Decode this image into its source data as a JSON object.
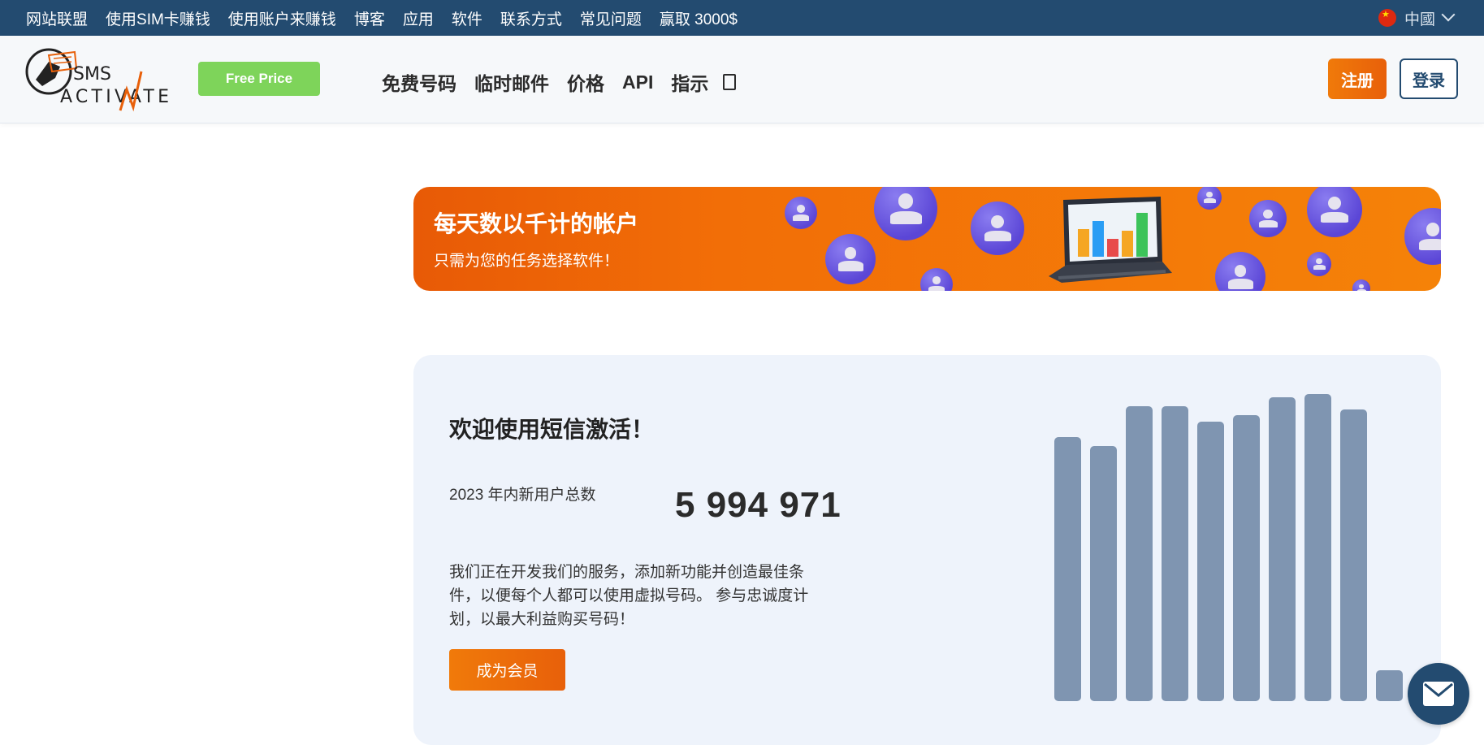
{
  "topbar": {
    "links": [
      "网站联盟",
      "使用SIM卡赚钱",
      "使用账户来赚钱",
      "博客",
      "应用",
      "软件",
      "联系方式",
      "常见问题",
      "赢取 3000$"
    ],
    "language": "中國",
    "flag_star": "★"
  },
  "header": {
    "logo_text_top": "SMS",
    "logo_text_bottom": "ACTIVATE",
    "free_price": "Free Price",
    "nav": [
      "免费号码",
      "临时邮件",
      "价格",
      "API",
      "指示"
    ],
    "register": "注册",
    "login": "登录"
  },
  "banner": {
    "title": "每天数以千计的帐户",
    "subtitle": "只需为您的任务选择软件！"
  },
  "card": {
    "welcome": "欢迎使用短信激活！",
    "stat_label": "2023 年内新用户总数",
    "stat_value": "5 994 971",
    "description": "我们正在开发我们的服务，添加新功能并创造最佳条件，以便每个人都可以使用虚拟号码。 参与忠诚度计划，以最大利益购买号码！",
    "member_button": "成为会员",
    "bar_levels": [
      0.86,
      0.83,
      0.96,
      0.96,
      0.91,
      0.93,
      0.99,
      1.0,
      0.95,
      0.1
    ]
  },
  "colors": {
    "topbar": "#234b70",
    "accent_orange": "#f07a0a",
    "free_price_green": "#7ed45a",
    "bar": "#7f95b1",
    "card_bg": "#eef3fb"
  },
  "icons": [
    "china-flag-icon",
    "chevron-down-icon",
    "doc-icon",
    "mail-icon"
  ]
}
